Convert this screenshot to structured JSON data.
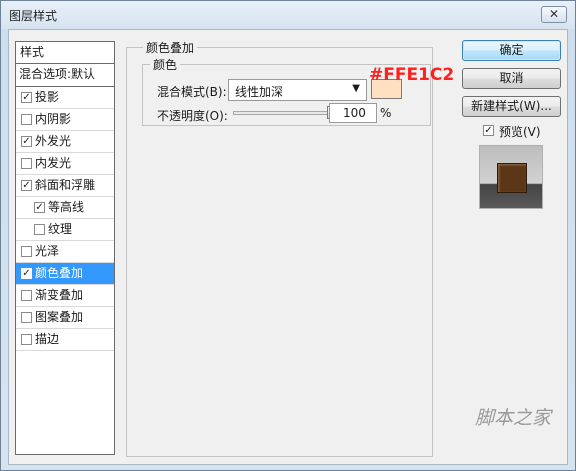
{
  "window": {
    "title": "图层样式",
    "close_glyph": "✕"
  },
  "style_list": {
    "header": "样式",
    "blend_options": "混合选项:默认",
    "items": [
      {
        "label": "投影",
        "checked": true,
        "indent": false,
        "selected": false,
        "name": "drop-shadow"
      },
      {
        "label": "内阴影",
        "checked": false,
        "indent": false,
        "selected": false,
        "name": "inner-shadow"
      },
      {
        "label": "外发光",
        "checked": true,
        "indent": false,
        "selected": false,
        "name": "outer-glow"
      },
      {
        "label": "内发光",
        "checked": false,
        "indent": false,
        "selected": false,
        "name": "inner-glow"
      },
      {
        "label": "斜面和浮雕",
        "checked": true,
        "indent": false,
        "selected": false,
        "name": "bevel-emboss"
      },
      {
        "label": "等高线",
        "checked": true,
        "indent": true,
        "selected": false,
        "name": "contour"
      },
      {
        "label": "纹理",
        "checked": false,
        "indent": true,
        "selected": false,
        "name": "texture"
      },
      {
        "label": "光泽",
        "checked": false,
        "indent": false,
        "selected": false,
        "name": "satin"
      },
      {
        "label": "颜色叠加",
        "checked": true,
        "indent": false,
        "selected": true,
        "name": "color-overlay"
      },
      {
        "label": "渐变叠加",
        "checked": false,
        "indent": false,
        "selected": false,
        "name": "gradient-overlay"
      },
      {
        "label": "图案叠加",
        "checked": false,
        "indent": false,
        "selected": false,
        "name": "pattern-overlay"
      },
      {
        "label": "描边",
        "checked": false,
        "indent": false,
        "selected": false,
        "name": "stroke"
      }
    ]
  },
  "color_overlay": {
    "section_title": "颜色叠加",
    "sub_title": "颜色",
    "blend_mode_label": "混合模式(B):",
    "blend_mode_value": "线性加深",
    "swatch_color": "#FFE1C2",
    "swatch_annotation": "#FFE1C2",
    "opacity_label": "不透明度(O):",
    "opacity_value": "100",
    "opacity_unit": "%",
    "opacity_fraction": 1.0
  },
  "actions": {
    "ok": "确定",
    "cancel": "取消",
    "new_style": "新建样式(W)...",
    "preview_label": "预览(V)",
    "preview_checked": true
  },
  "colors": {
    "selection": "#3399ff",
    "annotation": "#ff1f1f",
    "preview_fill": "#5b3717"
  },
  "watermark": "脚本之家"
}
